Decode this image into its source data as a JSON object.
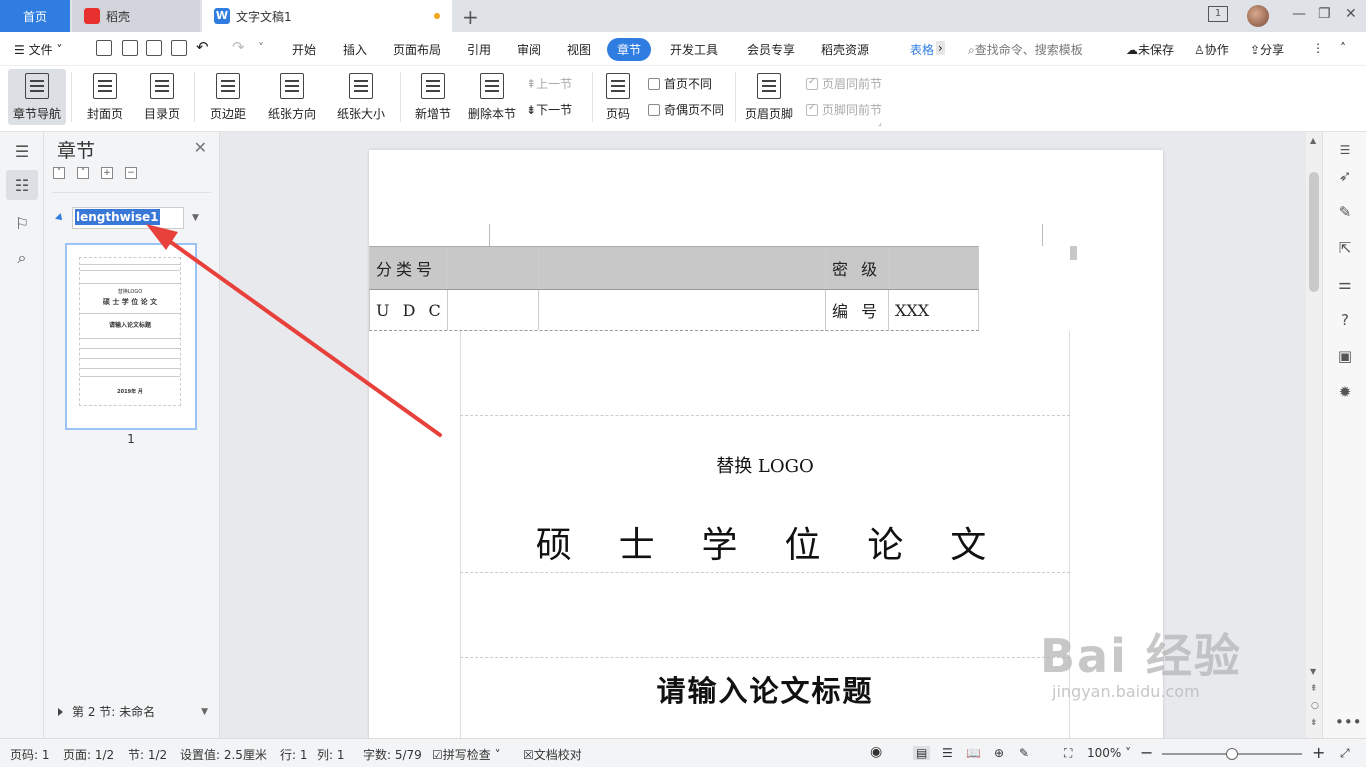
{
  "tabs": {
    "home": "首页",
    "daoke": "稻壳",
    "doc": "文字文稿1",
    "doc_logo": "W"
  },
  "window": {
    "page_count": "1"
  },
  "menu": {
    "file": "文件",
    "items": [
      "开始",
      "插入",
      "页面布局",
      "引用",
      "审阅",
      "视图",
      "章节",
      "开发工具",
      "会员专享",
      "稻壳资源",
      "表格"
    ],
    "active": "章节",
    "search": "查找命令、搜索模板",
    "unsaved": "未保存",
    "collab": "协作",
    "share": "分享"
  },
  "ribbon": {
    "section_nav": "章节导航",
    "cover": "封面页",
    "toc": "目录页",
    "margin": "页边距",
    "orientation": "纸张方向",
    "paper_size": "纸张大小",
    "new_section": "新增节",
    "delete_section": "删除本节",
    "prev_section": "上一节",
    "next_section": "下一节",
    "page_number": "页码",
    "first_page_diff": "首页不同",
    "odd_even_diff": "奇偶页不同",
    "header_footer": "页眉页脚",
    "header_same_prev": "页眉同前节",
    "footer_same_prev": "页脚同前节"
  },
  "panel": {
    "title": "章节",
    "section1_name": "lengthwise1",
    "thumb_page_number": "1",
    "section2": "第 2 节: 未命名",
    "thumb_texts": [
      "替换LOGO",
      "硕 士 学 位 论 文",
      "请输入论文标题",
      "2019年 月"
    ]
  },
  "document": {
    "table": {
      "row1": [
        "分类号",
        "",
        "",
        "密 级",
        ""
      ],
      "row2": [
        "U D C",
        "",
        "",
        "编 号",
        "XXX"
      ]
    },
    "logo_text": "替换 LOGO",
    "degree_title": "硕  士  学  位  论  文",
    "thesis_title": "请输入论文标题"
  },
  "status": {
    "page": "页码: 1",
    "pages": "页面: 1/2",
    "section": "节: 1/2",
    "setting": "设置值: 2.5厘米",
    "line": "行: 1",
    "col": "列: 1",
    "words": "字数: 5/79",
    "spell": "拼写检查",
    "proofread": "文档校对",
    "zoom": "100%",
    "zoom_level": 0.5
  },
  "watermark": {
    "brand": "Bai 经验",
    "url": "jingyan.baidu.com"
  },
  "colors": {
    "accent": "#2f7de1",
    "arrow": "#e8403a",
    "selection": "#3a78d8",
    "header_cell": "#c8c8c8"
  }
}
